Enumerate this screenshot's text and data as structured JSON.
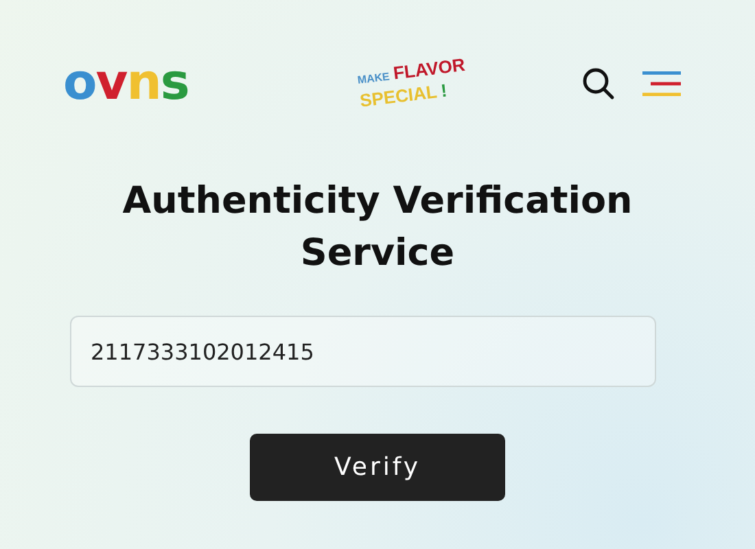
{
  "header": {
    "logo": [
      {
        "text": "o",
        "color": "#3a8fd0"
      },
      {
        "text": "v",
        "color": "#d0202e"
      },
      {
        "text": "n",
        "color": "#f0c030"
      },
      {
        "text": "s",
        "color": "#2a9a40"
      }
    ],
    "slogan": [
      {
        "text": "MAKE",
        "color": "#4a90c8"
      },
      {
        "text": "FLAVOR",
        "color": "#c0182a"
      },
      {
        "text": "SPECIAL",
        "color": "#e8c030"
      },
      {
        "text": "!",
        "color": "#2a9a40"
      }
    ]
  },
  "title": "Authenticity Verification Service",
  "code_field": {
    "value": "2117333102012415"
  },
  "buttons": [
    "Verify"
  ]
}
